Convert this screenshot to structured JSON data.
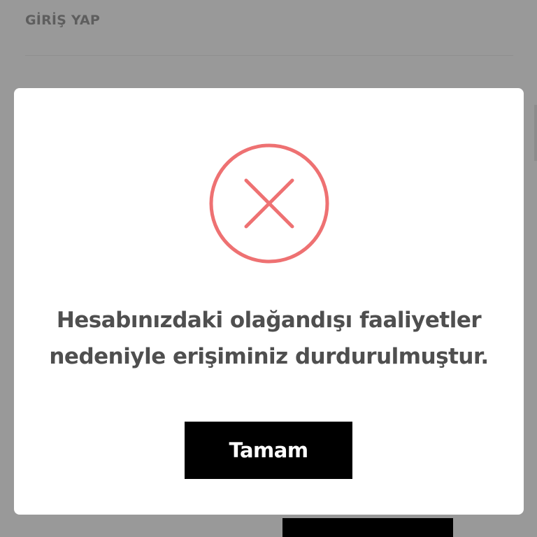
{
  "page": {
    "header_label": "GİRİŞ YAP"
  },
  "modal": {
    "icon": "error-x-circle-icon",
    "message_line1": "Hesabınızdaki olağandışı faaliyetler",
    "message_line2": "nedeniyle erişiminiz durdurulmuştur.",
    "ok_label": "Tamam"
  },
  "colors": {
    "overlay": "#999999",
    "modal_bg": "#ffffff",
    "error_accent": "#ee7172",
    "text": "#4f4f4f",
    "button_bg": "#000000",
    "button_text": "#ffffff"
  }
}
